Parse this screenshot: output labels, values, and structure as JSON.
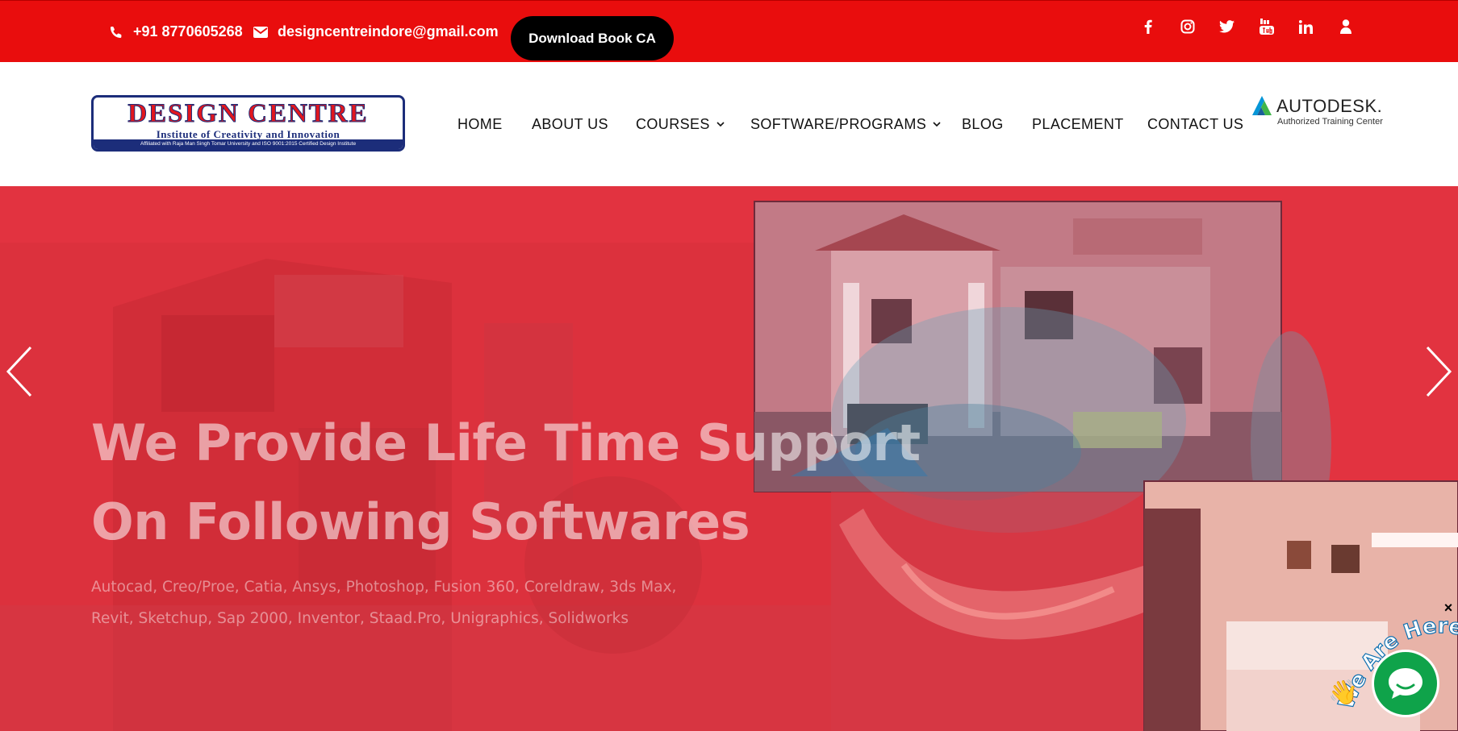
{
  "topbar": {
    "phone": "+91 8770605268",
    "email": "designcentreindore@gmail.com",
    "download_label": "Download Book CA",
    "social_icons": [
      "facebook-icon",
      "instagram-icon",
      "twitter-icon",
      "youtube-icon",
      "linkedin-icon",
      "user-icon"
    ]
  },
  "logo": {
    "title": "DESIGN CENTRE",
    "subtitle": "Institute of Creativity and Innovation",
    "strip": "Affiliated with Raja Man Singh Tomar University and ISO 9001:2015 Certified Design Institute"
  },
  "nav": {
    "home": "HOME",
    "about": "ABOUT US",
    "courses": "COURSES",
    "software": "SOFTWARE/PROGRAMS",
    "blog": "BLOG",
    "placement": "PLACEMENT",
    "contact": "CONTACT US"
  },
  "autodesk": {
    "name": "AUTODESK.",
    "sub": "Authorized Training Center"
  },
  "hero": {
    "title_line1": "We Provide Life Time Support",
    "title_line2": "On Following Softwares",
    "software_line1": "Autocad, Creo/Proe, Catia, Ansys, Photoshop, Fusion 360, Coreldraw, 3ds Max,",
    "software_line2": "Revit, Sketchup, Sap 2000, Inventor, Staad.Pro, Unigraphics, Solidworks"
  },
  "chat": {
    "badge": "We Are Here!",
    "close": "×"
  },
  "colors": {
    "topbar": "#e90d0d",
    "hero_overlay": "#e23340",
    "brand_blue": "#1c2d7a",
    "chat_green": "#0fa34a"
  }
}
